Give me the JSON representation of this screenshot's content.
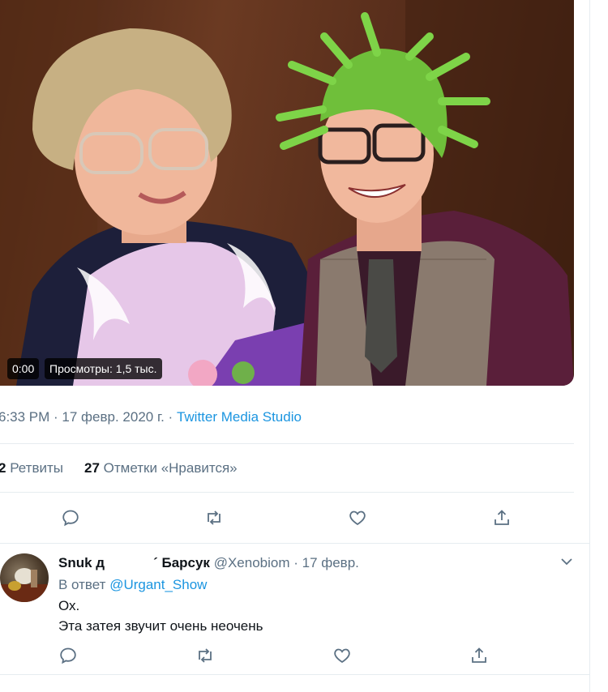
{
  "video": {
    "time": "0:00",
    "views": "Просмотры: 1,5 тыс."
  },
  "tweet": {
    "time": "6:33 PM",
    "separator": " · ",
    "date": "17 февр. 2020 г.",
    "source": "Twitter Media Studio",
    "retweets_count": "2",
    "retweets_label": "Ретвиты",
    "likes_count": "27",
    "likes_label": "Отметки «Нравится»"
  },
  "actions": {
    "reply": "reply-icon",
    "retweet": "retweet-icon",
    "like": "heart-icon",
    "share": "share-icon"
  },
  "reply": {
    "name_part1": "Snuk д",
    "name_part2": "Барсук",
    "handle": "@Xenobiom",
    "date": "17 февр.",
    "replying_prefix": "В ответ",
    "replying_to": "@Urgant_Show",
    "line1": "Ох.",
    "line2": "Эта затея звучит очень неочень"
  },
  "colors": {
    "link": "#1b95e0",
    "secondary_text": "#5b7083",
    "icon": "#5b7083",
    "divider": "#e6ecf0"
  }
}
